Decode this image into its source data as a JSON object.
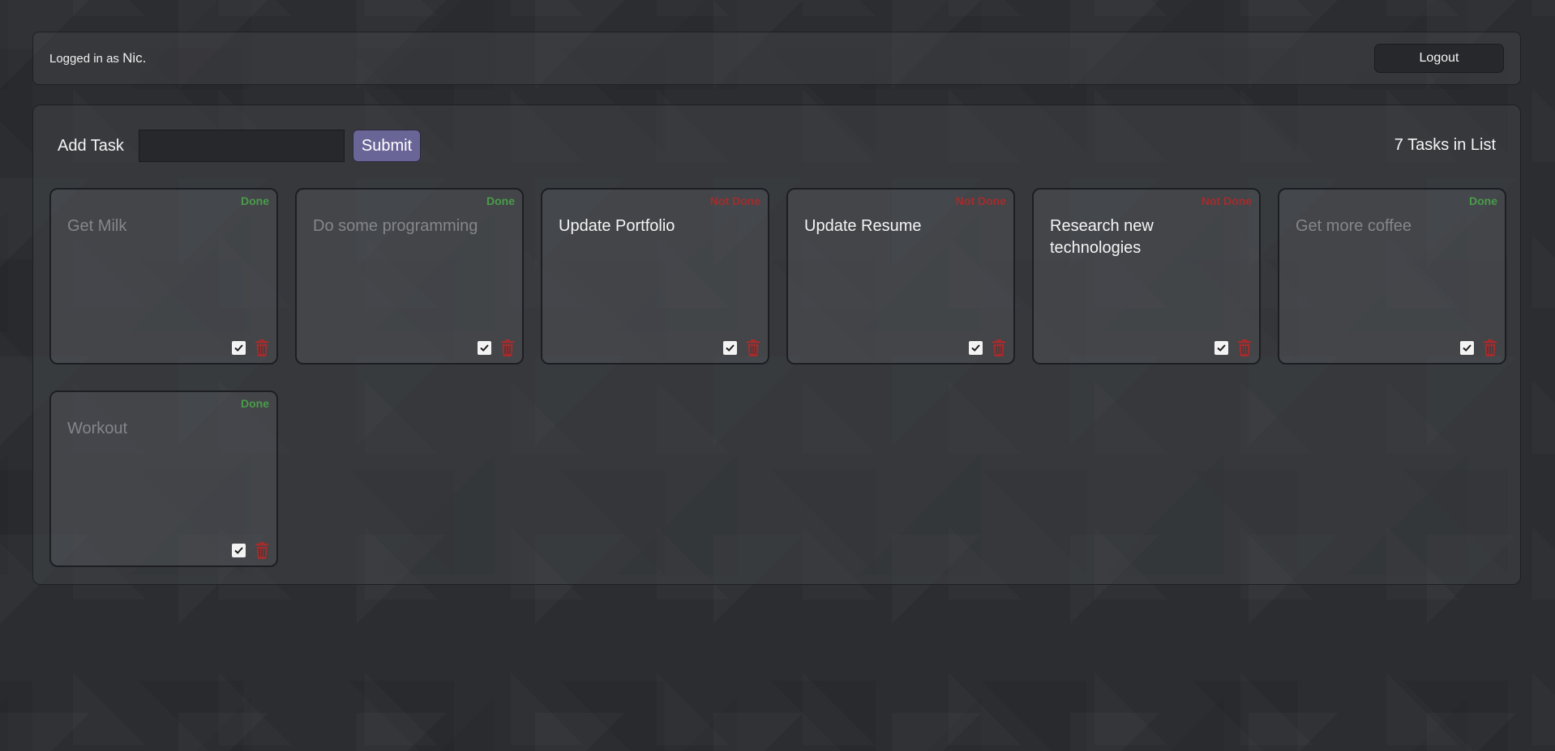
{
  "header": {
    "logged_in_prefix": "Logged in as ",
    "username": "Nic.",
    "logout_label": "Logout"
  },
  "add_task": {
    "label": "Add Task",
    "input_value": "",
    "input_placeholder": "",
    "submit_label": "Submit"
  },
  "task_count_label": "7 Tasks in List",
  "icons": {
    "complete": "checkbox-icon",
    "delete": "trash-icon"
  },
  "colors": {
    "done": "#4a9c4a",
    "not_done": "#a52c2c",
    "submit": "#6a6597",
    "trash": "#a52c2c"
  },
  "tasks": [
    {
      "text": "Get Milk",
      "status": "Done",
      "done": true
    },
    {
      "text": "Do some programming",
      "status": "Done",
      "done": true
    },
    {
      "text": "Update Portfolio",
      "status": "Not Done",
      "done": false
    },
    {
      "text": "Update Resume",
      "status": "Not Done",
      "done": false
    },
    {
      "text": "Research new technologies",
      "status": "Not Done",
      "done": false
    },
    {
      "text": "Get more coffee",
      "status": "Done",
      "done": true
    },
    {
      "text": "Workout",
      "status": "Done",
      "done": true
    }
  ]
}
